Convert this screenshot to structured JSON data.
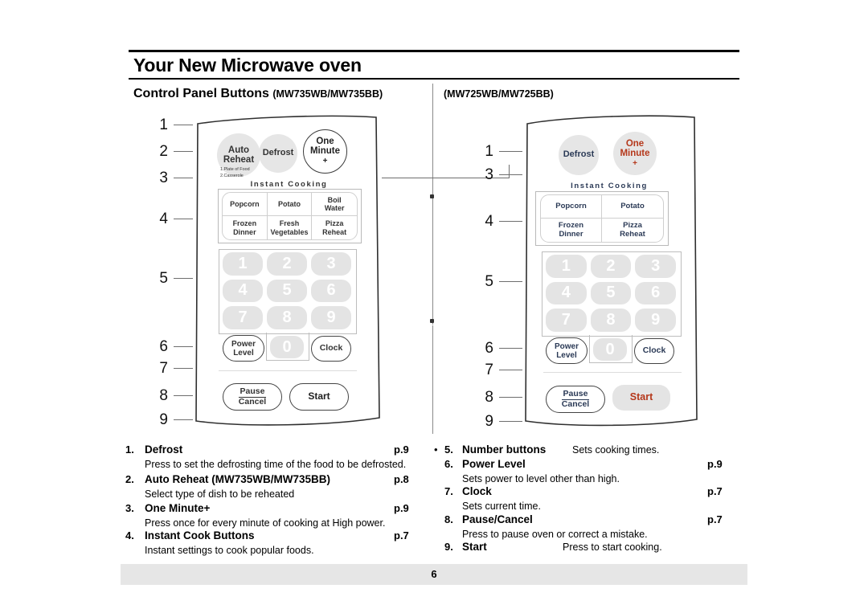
{
  "header": {
    "title": "Your New Microwave oven",
    "subtitle_left": "Control Panel Buttons",
    "subtitle_left_models": "(MW735WB/MW735BB)",
    "subtitle_right_models": "(MW725WB/MW725BB)"
  },
  "panel_left": {
    "model": "MW735WB/MW735BB",
    "auto_reheat": "Auto\nReheat",
    "auto_reheat_line1": "Auto",
    "auto_reheat_line2": "Reheat",
    "auto_reheat_sub1": "1.Plate of Food",
    "auto_reheat_sub2": "2.Casserole",
    "defrost": "Defrost",
    "one_minute_line1": "One",
    "one_minute_line2": "Minute",
    "one_minute_plus": "+",
    "instant_cooking_title": "Instant Cooking",
    "instant_cells": [
      "Popcorn",
      "Potato",
      "Boil\nWater",
      "Frozen\nDinner",
      "Fresh\nVegetables",
      "Pizza\nReheat"
    ],
    "keys": [
      "1",
      "2",
      "3",
      "4",
      "5",
      "6",
      "7",
      "8",
      "9"
    ],
    "zero_key": "0",
    "power_level_line1": "Power",
    "power_level_line2": "Level",
    "clock": "Clock",
    "pause_line1": "Pause",
    "pause_line2": "Cancel",
    "start": "Start"
  },
  "panel_right": {
    "model": "MW725WB/MW725BB",
    "defrost": "Defrost",
    "one_minute_line1": "One",
    "one_minute_line2": "Minute",
    "one_minute_plus": "+",
    "instant_cooking_title": "Instant Cooking",
    "instant_cells": [
      "Popcorn",
      "Potato",
      "Frozen\nDinner",
      "Pizza\nReheat"
    ],
    "keys": [
      "1",
      "2",
      "3",
      "4",
      "5",
      "6",
      "7",
      "8",
      "9"
    ],
    "zero_key": "0",
    "power_level_line1": "Power",
    "power_level_line2": "Level",
    "clock": "Clock",
    "pause_line1": "Pause",
    "pause_line2": "Cancel",
    "start": "Start"
  },
  "callouts_left": [
    "1",
    "2",
    "3",
    "4",
    "5",
    "6",
    "7",
    "8",
    "9"
  ],
  "callouts_right": [
    "1",
    "3",
    "4",
    "5",
    "6",
    "7",
    "8",
    "9"
  ],
  "legend_left": [
    {
      "num": "1.",
      "title": "Defrost",
      "page": "p.9",
      "desc": "Press to set the defrosting time of the food to be defrosted."
    },
    {
      "num": "2.",
      "title": "Auto Reheat (MW735WB/MW735BB)",
      "page": "p.8",
      "desc": "Select type of dish to be reheated"
    },
    {
      "num": "3.",
      "title": "One Minute+",
      "page": "p.9",
      "desc": "Press once for every minute of cooking at High power."
    },
    {
      "num": "4.",
      "title": "Instant Cook Buttons",
      "page": "p.7",
      "desc": "Instant settings to cook popular foods."
    }
  ],
  "legend_right": [
    {
      "num": "5.",
      "title": "Number buttons",
      "page": "",
      "inline": "Sets cooking times.",
      "desc": ""
    },
    {
      "num": "6.",
      "title": "Power Level",
      "page": "p.9",
      "inline": "",
      "desc": "Sets power to level other than high."
    },
    {
      "num": "7.",
      "title": "Clock",
      "page": "p.7",
      "inline": "",
      "desc": "Sets current time."
    },
    {
      "num": "8.",
      "title": "Pause/Cancel",
      "page": "p.7",
      "inline": "",
      "desc": "Press to pause oven or correct a mistake."
    },
    {
      "num": "9.",
      "title": "Start",
      "page": "",
      "inline": "Press to start cooking.",
      "desc": ""
    }
  ],
  "footer": {
    "page_number": "6"
  },
  "colors": {
    "accent_red": "#b5381b",
    "panel_text_blue": "#2b3a56",
    "key_gray": "#e4e4e4",
    "panel_line": "#333333",
    "footer_bar": "#e6e6e6"
  }
}
